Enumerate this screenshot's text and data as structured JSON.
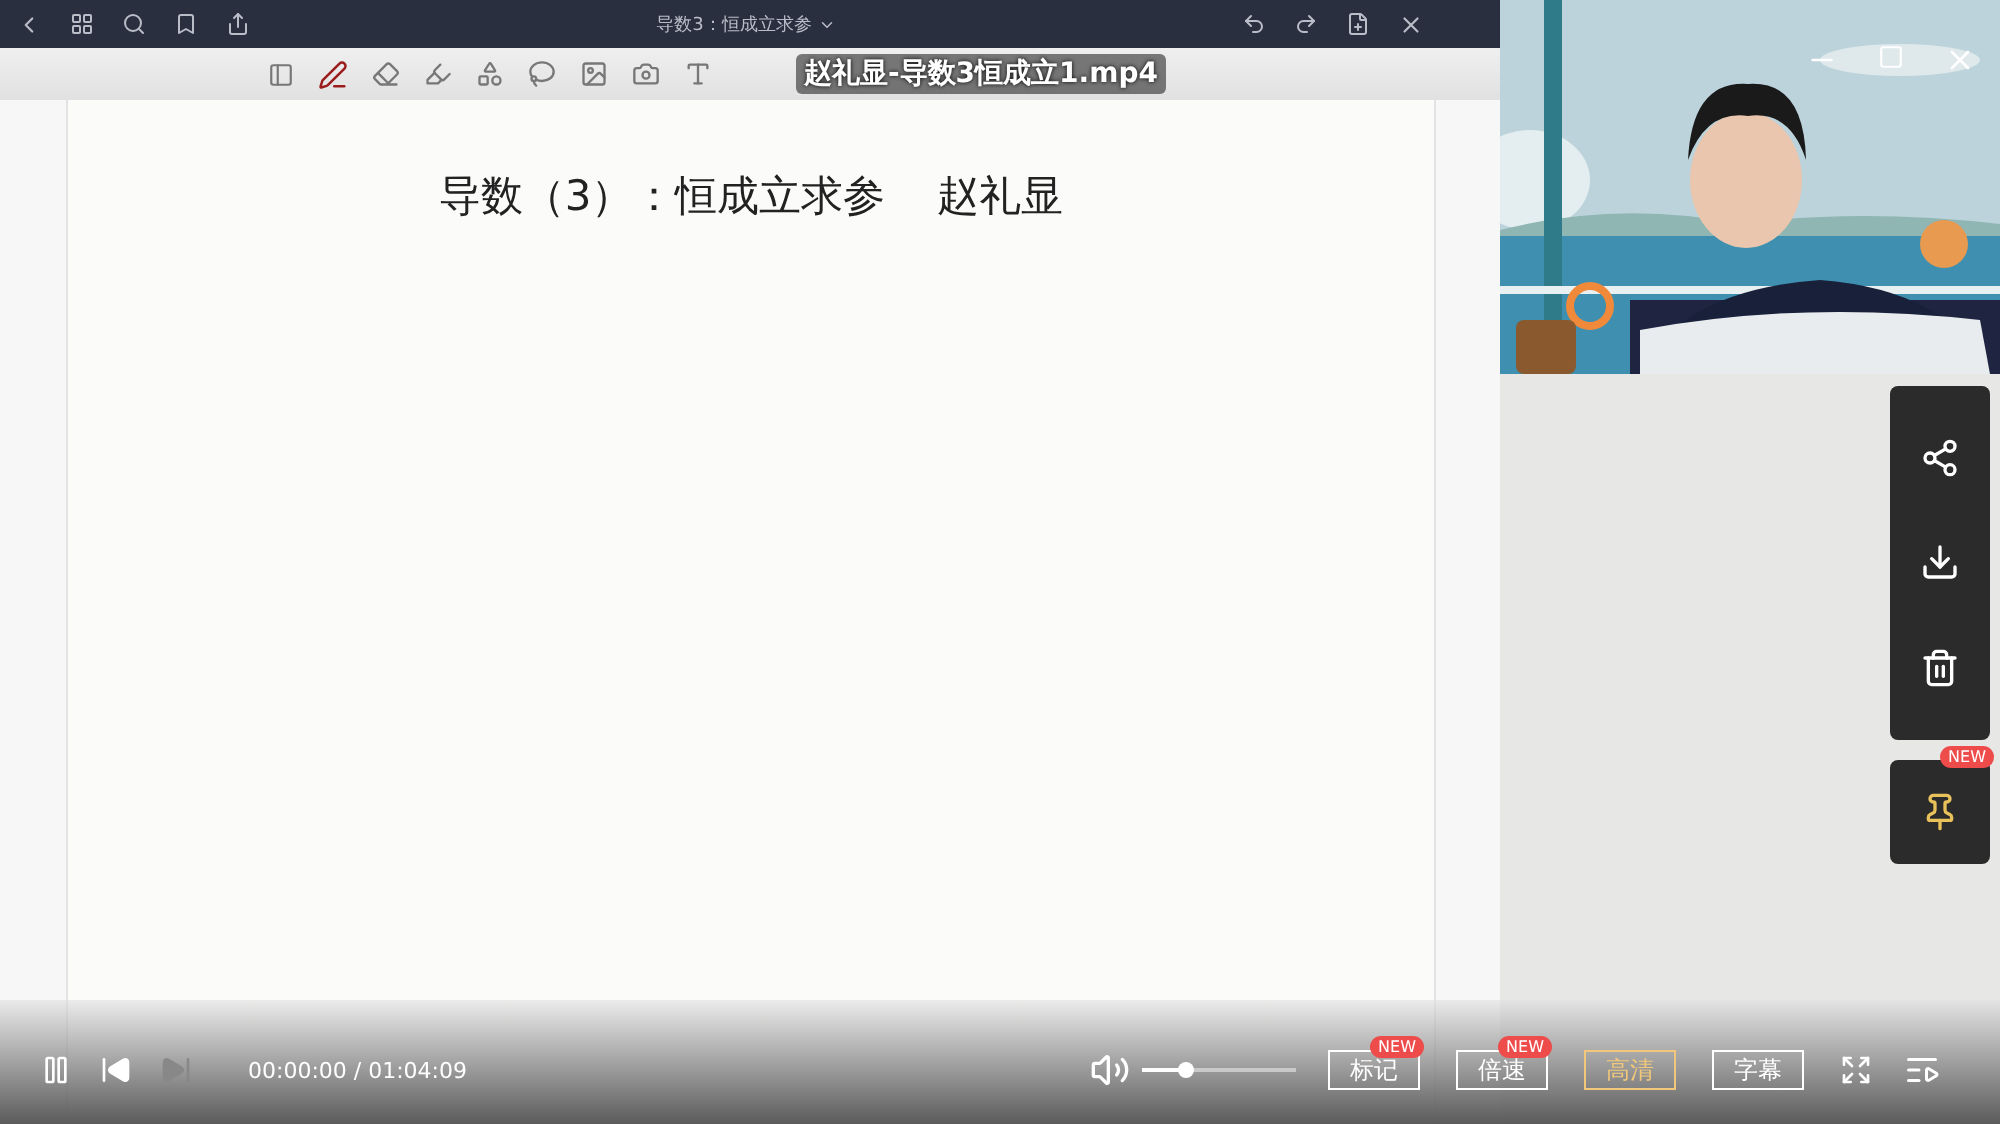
{
  "app_bar": {
    "title": "导数3：恒成立求参"
  },
  "video_title": "赵礼显-导数3恒成立1.mp4",
  "board": {
    "heading": "导数（3）：恒成立求参",
    "author": "赵礼显"
  },
  "side_panel": {
    "pin_badge": "NEW"
  },
  "player": {
    "playing": true,
    "time": "00:00:00 / 01:04:09",
    "volume": {
      "level": 0.28
    },
    "buttons": [
      {
        "label": "标记",
        "badge": "NEW",
        "selected": false
      },
      {
        "label": "倍速",
        "badge": "NEW",
        "selected": false
      },
      {
        "label": "高清",
        "selected": true
      },
      {
        "label": "字幕",
        "selected": false
      }
    ]
  }
}
